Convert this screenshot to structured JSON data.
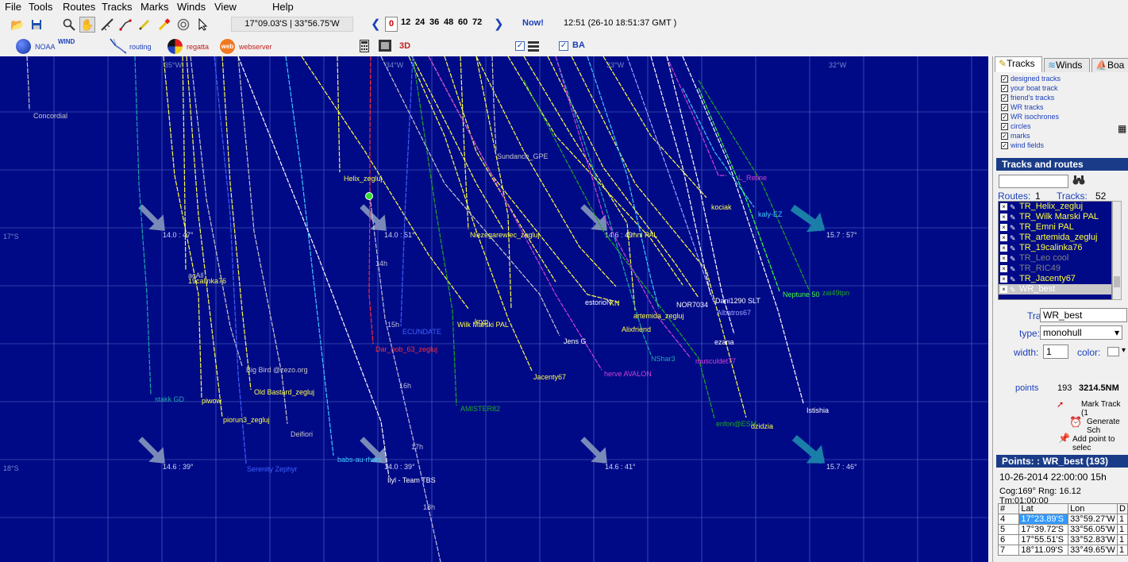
{
  "menu": [
    "File",
    "Tools",
    "Routes",
    "Tracks",
    "Marks",
    "Winds",
    "View",
    "Help"
  ],
  "toolbar": {
    "coord": "17°09.03'S | 33°56.75'W",
    "hour_selected": "0",
    "hours": [
      "12",
      "24",
      "36",
      "48",
      "60",
      "72"
    ],
    "now_label": "Now!",
    "clock": "12:51 (26-10 18:51:37 GMT )"
  },
  "toolbar2": {
    "noaa": "NOAA",
    "wind": "WIND",
    "routing": "routing",
    "regatta": "regatta",
    "web": "web",
    "webserver": "webserver",
    "label_3d": "3D",
    "ba": "BA"
  },
  "map": {
    "longitudes": [
      "35°W",
      "34°W",
      "33°W",
      "32°W"
    ],
    "latitudes": [
      "17°S",
      "18°S"
    ],
    "wind_labels": [
      "14.0 : 47°",
      "14.0 : 51°",
      "14.6 : 49°",
      "15.7 : 57°",
      "14.6 : 39°",
      "14.0 : 39°",
      "14.6 : 41°",
      "15.7 : 46°"
    ],
    "boats": [
      {
        "name": "Concordial",
        "color": "#c8c8c8"
      },
      {
        "name": "Helix_zegluj",
        "color": "#ffff4a"
      },
      {
        "name": "Sundance_GPE",
        "color": "#c8c8c8"
      },
      {
        "name": "L_Retine",
        "color": "#d040d8"
      },
      {
        "name": "kociak",
        "color": "#ffff4a"
      },
      {
        "name": "kaly-EZ",
        "color": "#40c8ff"
      },
      {
        "name": "Niezegarewiec_zegluj",
        "color": "#ffff4a"
      },
      {
        "name": "Emni PAL",
        "color": "#ffff4a"
      },
      {
        "name": "Neptune 50",
        "color": "#40ff40"
      },
      {
        "name": "zai49tpn",
        "color": "#20a820"
      },
      {
        "name": "acAll",
        "color": "#c8c8c8"
      },
      {
        "name": "19calinka76",
        "color": "#ffff4a"
      },
      {
        "name": "estorioN",
        "color": "#ffffff"
      },
      {
        "name": "KN",
        "color": "#ffff4a"
      },
      {
        "name": "NOR7034",
        "color": "#ffffff"
      },
      {
        "name": "Dani1290 SLT",
        "color": "#ffffff"
      },
      {
        "name": "artemida_zegluj",
        "color": "#ffff4a"
      },
      {
        "name": "Albatros67",
        "color": "#a0a0ff"
      },
      {
        "name": "Alixfriend",
        "color": "#ffff4a"
      },
      {
        "name": "kryp",
        "color": "#ffff4a"
      },
      {
        "name": "Wilk Marski PAL",
        "color": "#ffff4a"
      },
      {
        "name": "ECUNDATE",
        "color": "#4060ff"
      },
      {
        "name": "Jens G",
        "color": "#ffffff"
      },
      {
        "name": "ezana",
        "color": "#ffffff"
      },
      {
        "name": "Dar_bob_63_zegluj",
        "color": "#ff3030"
      },
      {
        "name": "NShar3",
        "color": "#20a8a8"
      },
      {
        "name": "musculdet77",
        "color": "#d040d8"
      },
      {
        "name": "herve AVALON",
        "color": "#d040d8"
      },
      {
        "name": "Jacenty67",
        "color": "#ffff4a"
      },
      {
        "name": "Big Bird @zezo.org",
        "color": "#c8c8c8"
      },
      {
        "name": "Old Bastard_zegluj",
        "color": "#ffff4a"
      },
      {
        "name": "stakk GD",
        "color": "#20a8a8"
      },
      {
        "name": "piwow",
        "color": "#ffff4a"
      },
      {
        "name": "piorun3_zegluj",
        "color": "#ffff4a"
      },
      {
        "name": "AMISTER82",
        "color": "#20a820"
      },
      {
        "name": "Deifiori",
        "color": "#c8c8c8"
      },
      {
        "name": "enfon@ESM",
        "color": "#20a820"
      },
      {
        "name": "dzidzia",
        "color": "#ffff4a"
      },
      {
        "name": "Istishia",
        "color": "#ffffff"
      },
      {
        "name": "babs-au-rhum",
        "color": "#40c8ff"
      },
      {
        "name": "Serenity Zephyr",
        "color": "#4060ff"
      },
      {
        "name": "Ilyl - Team TBS",
        "color": "#ffffff"
      }
    ],
    "hour_marks": [
      "14h",
      "15h",
      "16h",
      "17h",
      "18h"
    ]
  },
  "panel": {
    "tabs": [
      "Tracks",
      "Winds",
      "Boa"
    ],
    "checks": [
      "designed  tracks",
      "your boat track",
      "friend's tracks",
      "WR tracks",
      "WR isochrones",
      "circles",
      "marks",
      "wind fields"
    ],
    "tracks_header": "Tracks and routes",
    "routes_label": "Routes:",
    "routes_count": "1",
    "tracks_label": "Tracks:",
    "tracks_count": "52",
    "route_items": [
      "TR_Helix_zegluj",
      "TR_Wilk Marski PAL",
      "TR_Emni PAL",
      "TR_artemida_zegluj",
      "TR_19calinka76",
      "TR_Leo cool",
      "TR_RIC49",
      "TR_Jacenty67",
      "WR_best"
    ],
    "track_label": "Track:",
    "track_value": "WR_best",
    "type_label": "type:",
    "type_value": "monohull",
    "width_label": "width:",
    "width_value": "1",
    "color_label": "color:",
    "points_label": "points",
    "points_value": "193",
    "distance": "3214.5NM",
    "mark_track": "Mark Track (1",
    "generate": "Generate Sch",
    "add_point": "Add point to selec",
    "points_header": "Points: : WR_best (193)",
    "points_date": "10-26-2014 22:00:00 15h",
    "points_info": "Cog:169° Rng: 16.12 Tm:01:00:00",
    "table_headers": [
      "#",
      "Lat",
      "Lon",
      "D"
    ],
    "table_rows": [
      [
        "4",
        "17°23.89'S",
        "33°59.27'W",
        "1"
      ],
      [
        "5",
        "17°39.72'S",
        "33°56.05'W",
        "1"
      ],
      [
        "6",
        "17°55.51'S",
        "33°52.83'W",
        "1"
      ],
      [
        "7",
        "18°11.09'S",
        "33°49.65'W",
        "1"
      ]
    ]
  }
}
